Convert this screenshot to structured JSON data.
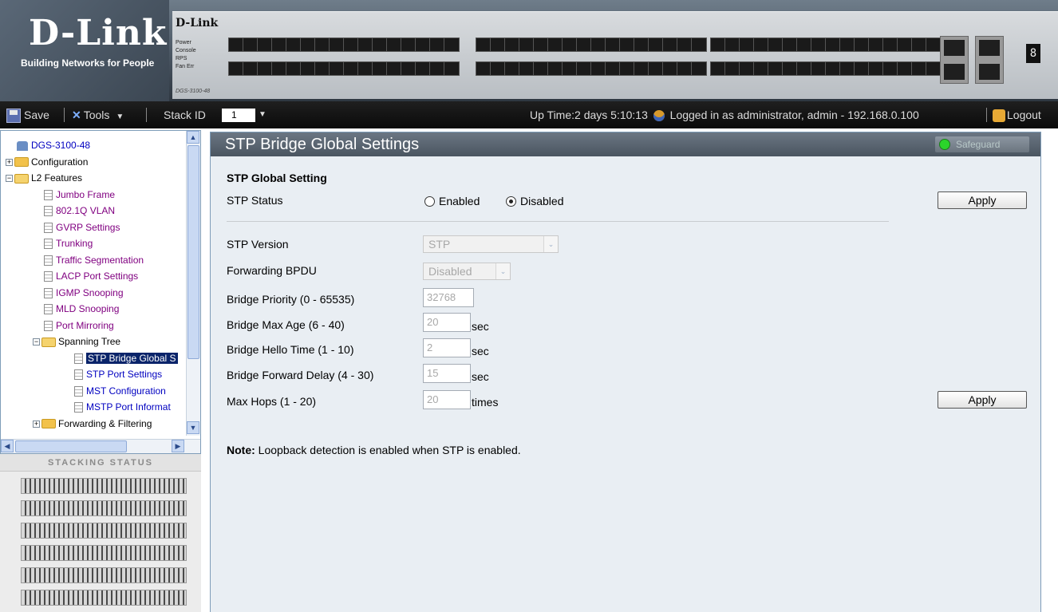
{
  "brand": {
    "name": "D-Link",
    "tagline": "Building Networks for People"
  },
  "device": {
    "brand": "D-Link",
    "leds": [
      "Power",
      "Console",
      "RPS",
      "Fan Err"
    ],
    "model": "DGS-3100-48",
    "master_digit": "8"
  },
  "toolbar": {
    "save": "Save",
    "tools": "Tools",
    "stack_id_label": "Stack ID",
    "stack_id_value": "1",
    "status": "Up Time:2 days 5:10:13",
    "login": "Logged in as administrator, admin - 192.168.0.100",
    "logout": "Logout"
  },
  "tree": {
    "root": "DGS-3100-48",
    "items": [
      "Configuration",
      "L2 Features",
      "Jumbo Frame",
      "802.1Q VLAN",
      "GVRP Settings",
      "Trunking",
      "Traffic Segmentation",
      "LACP Port Settings",
      "IGMP Snooping",
      "MLD Snooping",
      "Port Mirroring",
      "Spanning Tree",
      "STP Bridge Global S",
      "STP Port Settings",
      "MST Configuration",
      "MSTP Port Informat",
      "Forwarding & Filtering"
    ]
  },
  "stacking": {
    "title": "STACKING STATUS"
  },
  "page": {
    "title": "STP Bridge Global Settings",
    "safeguard": "Safeguard",
    "section": "STP Global Setting",
    "stp_status_label": "STP Status",
    "enabled": "Enabled",
    "disabled": "Disabled",
    "apply": "Apply",
    "stp_version_label": "STP Version",
    "stp_version_value": "STP",
    "fwd_bpdu_label": "Forwarding BPDU",
    "fwd_bpdu_value": "Disabled",
    "priority_label": "Bridge Priority (0 - 65535)",
    "priority_value": "32768",
    "max_age_label": "Bridge Max Age (6 - 40)",
    "max_age_value": "20",
    "hello_label": "Bridge Hello Time (1 - 10)",
    "hello_value": "2",
    "fwd_delay_label": "Bridge Forward  Delay (4 - 30)",
    "fwd_delay_value": "15",
    "max_hops_label": "Max Hops (1 - 20)",
    "max_hops_value": "20",
    "sec": "sec",
    "times": "times",
    "note_prefix": "Note:",
    "note_text": " Loopback detection is enabled when STP is enabled."
  }
}
